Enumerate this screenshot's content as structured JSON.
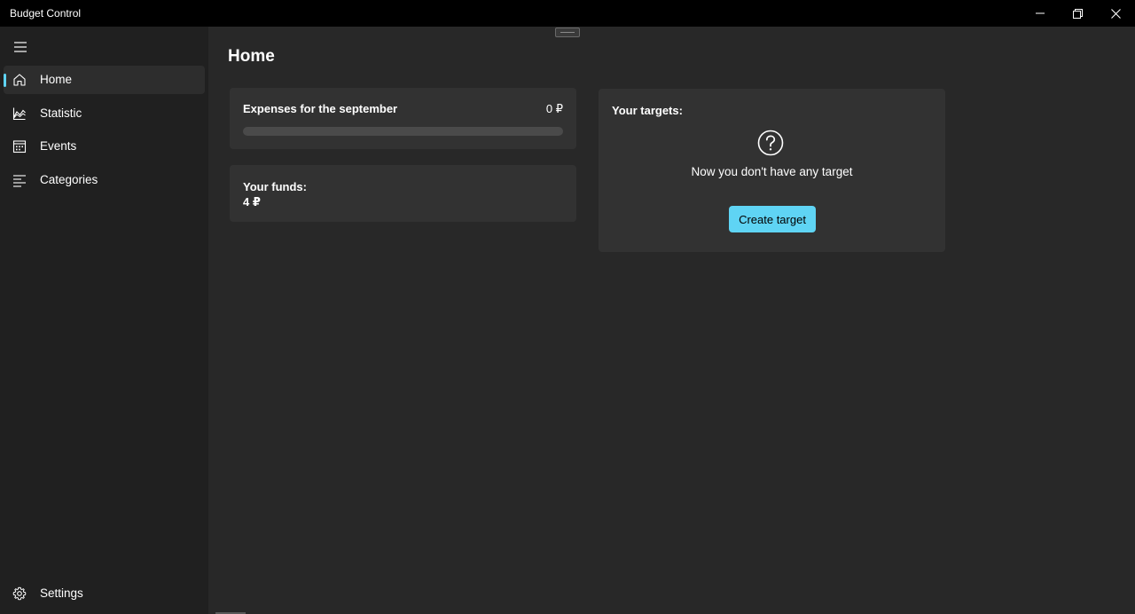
{
  "window": {
    "title": "Budget Control"
  },
  "sidebar": {
    "items": [
      {
        "label": "Home",
        "icon": "home-icon",
        "active": true
      },
      {
        "label": "Statistic",
        "icon": "chart-icon",
        "active": false
      },
      {
        "label": "Events",
        "icon": "calendar-icon",
        "active": false
      },
      {
        "label": "Categories",
        "icon": "list-icon",
        "active": false
      }
    ],
    "footer": {
      "label": "Settings",
      "icon": "gear-icon"
    }
  },
  "page": {
    "title": "Home"
  },
  "expenses": {
    "title": "Expenses for the september",
    "value": "0 ₽",
    "progress": 0
  },
  "funds": {
    "label": "Your funds:",
    "value": "4 ₽"
  },
  "targets": {
    "title": "Your targets:",
    "empty_text": "Now you don't have any target",
    "create_label": "Create target"
  },
  "colors": {
    "accent": "#5fd4f4",
    "background": "#282828",
    "sidebar": "#202020",
    "card": "#323232",
    "titlebar": "#000000"
  }
}
